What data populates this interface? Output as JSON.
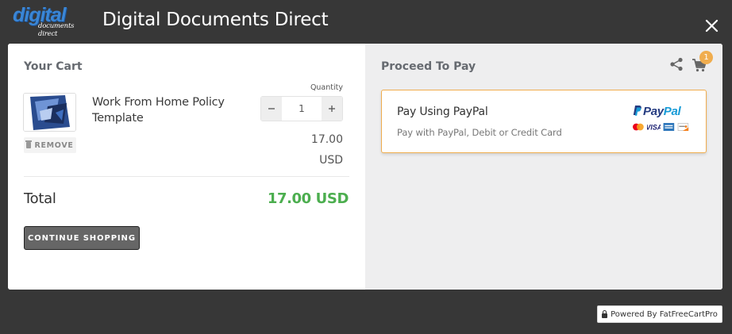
{
  "header": {
    "logo_main": "digital",
    "logo_sub": "documents direct",
    "title": "Digital Documents Direct",
    "close_icon": "close-icon"
  },
  "cart": {
    "heading": "Your Cart",
    "items": [
      {
        "name": "Work From Home Policy Template",
        "thumbnail_icon": "document-thumbnail",
        "remove_label": "REMOVE",
        "quantity_label": "Quantity",
        "quantity": "1",
        "price_amount": "17.00",
        "price_currency": "USD"
      }
    ],
    "total_label": "Total",
    "total_value": "17.00 USD",
    "continue_label": "CONTINUE SHOPPING"
  },
  "payment": {
    "heading": "Proceed To Pay",
    "cart_badge": "1",
    "option": {
      "title": "Pay Using PayPal",
      "description": "Pay with PayPal, Debit or Credit Card",
      "logo_text_1": "Pay",
      "logo_text_2": "Pal",
      "cards": [
        "mastercard",
        "visa",
        "amex",
        "discover"
      ]
    }
  },
  "footer": {
    "powered_by": "Powered By FatFreeCartPro"
  },
  "colors": {
    "page_bg": "#373737",
    "total_green": "#4cae4f",
    "accent_orange": "#f0ad4e",
    "pay_pane_bg": "#eeeeef"
  }
}
